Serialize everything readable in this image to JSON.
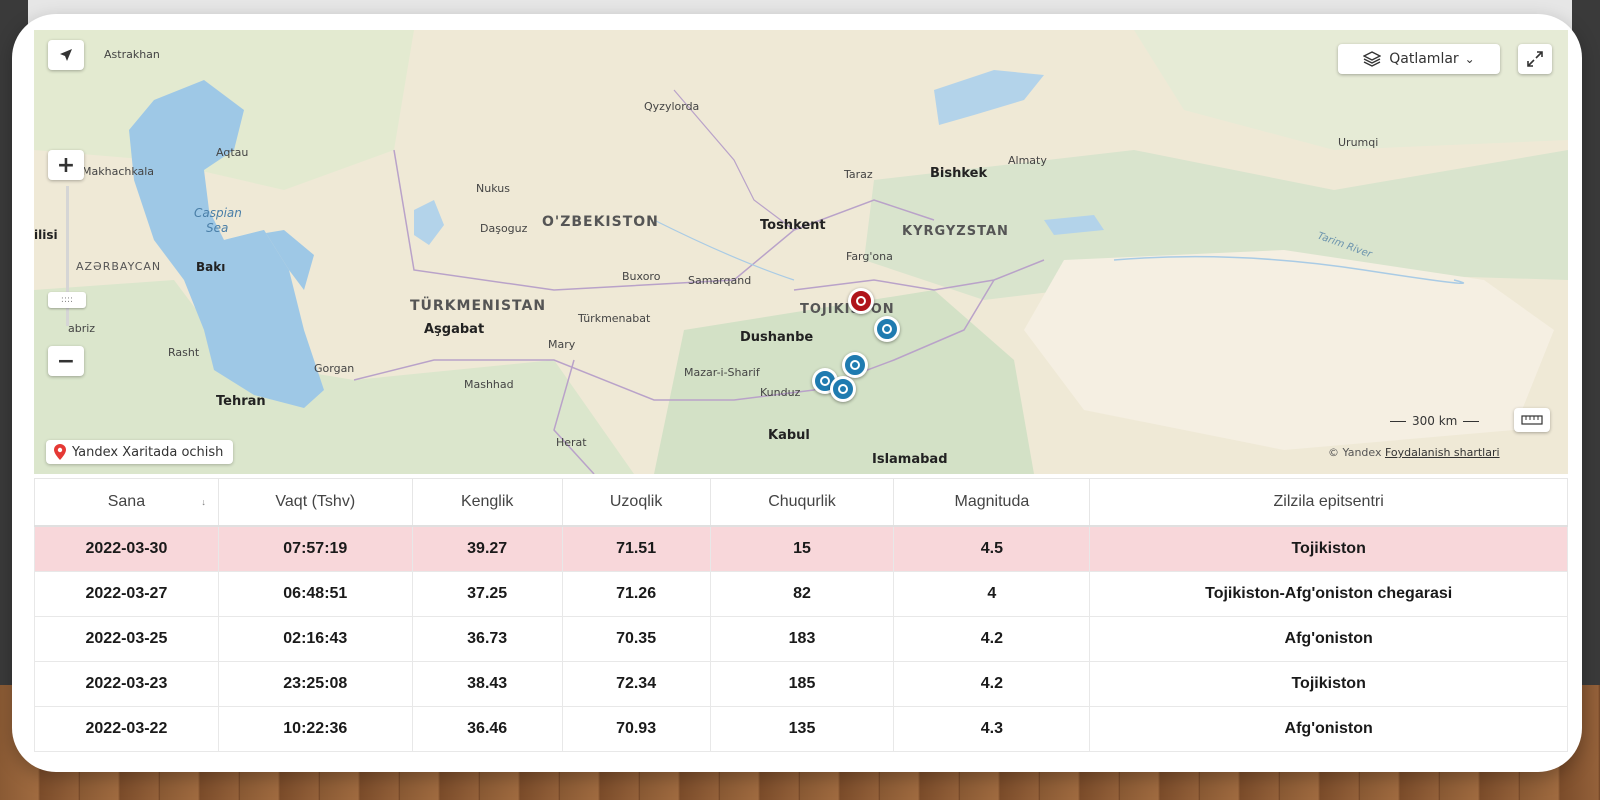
{
  "map": {
    "layers_label": "Qatlamlar",
    "open_in_yandex": "Yandex Xaritada ochish",
    "scale_label": "300 km",
    "copyright": "© Yandex",
    "terms_link": "Foydalanish shartlari",
    "labels": {
      "astrakhan": "Astrakhan",
      "aqtau": "Aqtau",
      "makhachkala": "Makhachkala",
      "caspian": "Caspian",
      "sea": "Sea",
      "tbilisi": "ilisi",
      "azerbaycan": "AZƏRBAYCAN",
      "baki": "Bakı",
      "tabriz": "abriz",
      "rasht": "Rasht",
      "gorgan": "Gorgan",
      "tehran": "Tehran",
      "qyzylorda": "Qyzylorda",
      "nukus": "Nukus",
      "dasoguz": "Daşoguz",
      "ozbekiston": "O'ZBEKISTON",
      "buxoro": "Buxoro",
      "samarqand": "Samarqand",
      "turkmenistan": "TÜRKMENISTAN",
      "turkmenabat": "Türkmenabat",
      "asgabat": "Aşgabat",
      "mary": "Mary",
      "mashhad": "Mashhad",
      "herat": "Herat",
      "mazar": "Mazar-i-Sharif",
      "kunduz": "Kunduz",
      "kabul": "Kabul",
      "islamabad": "Islamabad",
      "toshkent": "Toshkent",
      "dushanbe": "Dushanbe",
      "tojikiston": "TOJIKISTON",
      "fargona": "Farg'ona",
      "kyrgyzstan": "KYRGYZSTAN",
      "taraz": "Taraz",
      "bishkek": "Bishkek",
      "almaty": "Almaty",
      "urumqi": "Urumqi",
      "tarim": "Tarim River"
    }
  },
  "table": {
    "headers": [
      "Sana",
      "Vaqt (Tshv)",
      "Kenglik",
      "Uzoqlik",
      "Chuqurlik",
      "Magnituda",
      "Zilzila epitsentri"
    ],
    "rows": [
      {
        "date": "2022-03-30",
        "time": "07:57:19",
        "lat": "39.27",
        "lon": "71.51",
        "depth": "15",
        "mag": "4.5",
        "epicenter": "Tojikiston"
      },
      {
        "date": "2022-03-27",
        "time": "06:48:51",
        "lat": "37.25",
        "lon": "71.26",
        "depth": "82",
        "mag": "4",
        "epicenter": "Tojikiston-Afg'oniston chegarasi"
      },
      {
        "date": "2022-03-25",
        "time": "02:16:43",
        "lat": "36.73",
        "lon": "70.35",
        "depth": "183",
        "mag": "4.2",
        "epicenter": "Afg'oniston"
      },
      {
        "date": "2022-03-23",
        "time": "23:25:08",
        "lat": "38.43",
        "lon": "72.34",
        "depth": "185",
        "mag": "4.2",
        "epicenter": "Tojikiston"
      },
      {
        "date": "2022-03-22",
        "time": "10:22:36",
        "lat": "36.46",
        "lon": "70.93",
        "depth": "135",
        "mag": "4.3",
        "epicenter": "Afg'oniston"
      }
    ]
  },
  "colors": {
    "highlight_row": "#f8d7da",
    "marker_latest": "#b0141a",
    "marker_other": "#1f7bb0"
  }
}
